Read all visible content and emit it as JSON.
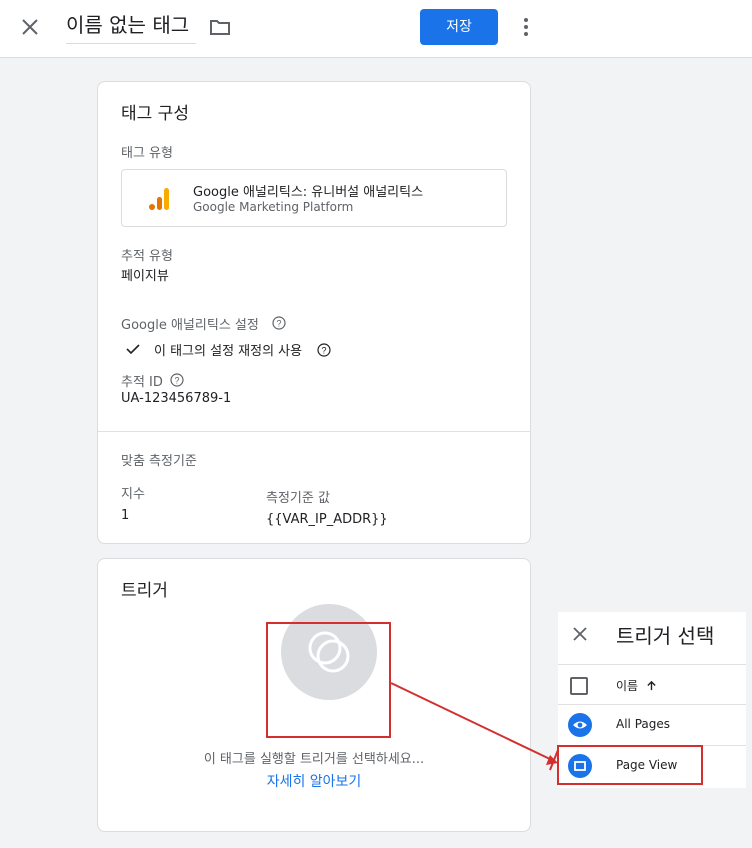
{
  "header": {
    "tag_title": "이름 없는 태그",
    "save_label": "저장",
    "close_icon": "close-icon",
    "folder_icon": "folder-icon",
    "more_icon": "more-vert-icon"
  },
  "tag_config": {
    "title": "태그 구성",
    "tag_type_label": "태그 유형",
    "tag_type_name": "Google 애널리틱스: 유니버설 애널리틱스",
    "tag_type_provider": "Google Marketing Platform",
    "tracking_type_label": "추적 유형",
    "tracking_type_value": "페이지뷰",
    "ga_settings_label": "Google 애널리틱스 설정",
    "override_label": "이 태그의 설정 재정의 사용",
    "tracking_id_label": "추적 ID",
    "tracking_id_value": "UA-123456789-1",
    "custom_metrics_label": "맞춤 측정기준",
    "index_header": "지수",
    "dimension_value_header": "측정기준 값",
    "index_value": "1",
    "dimension_value": "{{VAR_IP_ADDR}}"
  },
  "triggering": {
    "title": "트리거",
    "prompt": "이 태그를 실행할 트리거를 선택하세요...",
    "learn_more": "자세히 알아보기"
  },
  "trigger_panel": {
    "title": "트리거 선택",
    "name_column": "이름",
    "sort_icon": "arrow-up-icon",
    "items": [
      {
        "name": "All Pages",
        "icon": "eye-icon"
      },
      {
        "name": "Page View",
        "icon": "page-view-icon"
      }
    ]
  },
  "colors": {
    "accent": "#1a73e8",
    "highlight": "#d32f2f",
    "ga_orange": "#f9ab00",
    "ga_dark_orange": "#e37400"
  }
}
